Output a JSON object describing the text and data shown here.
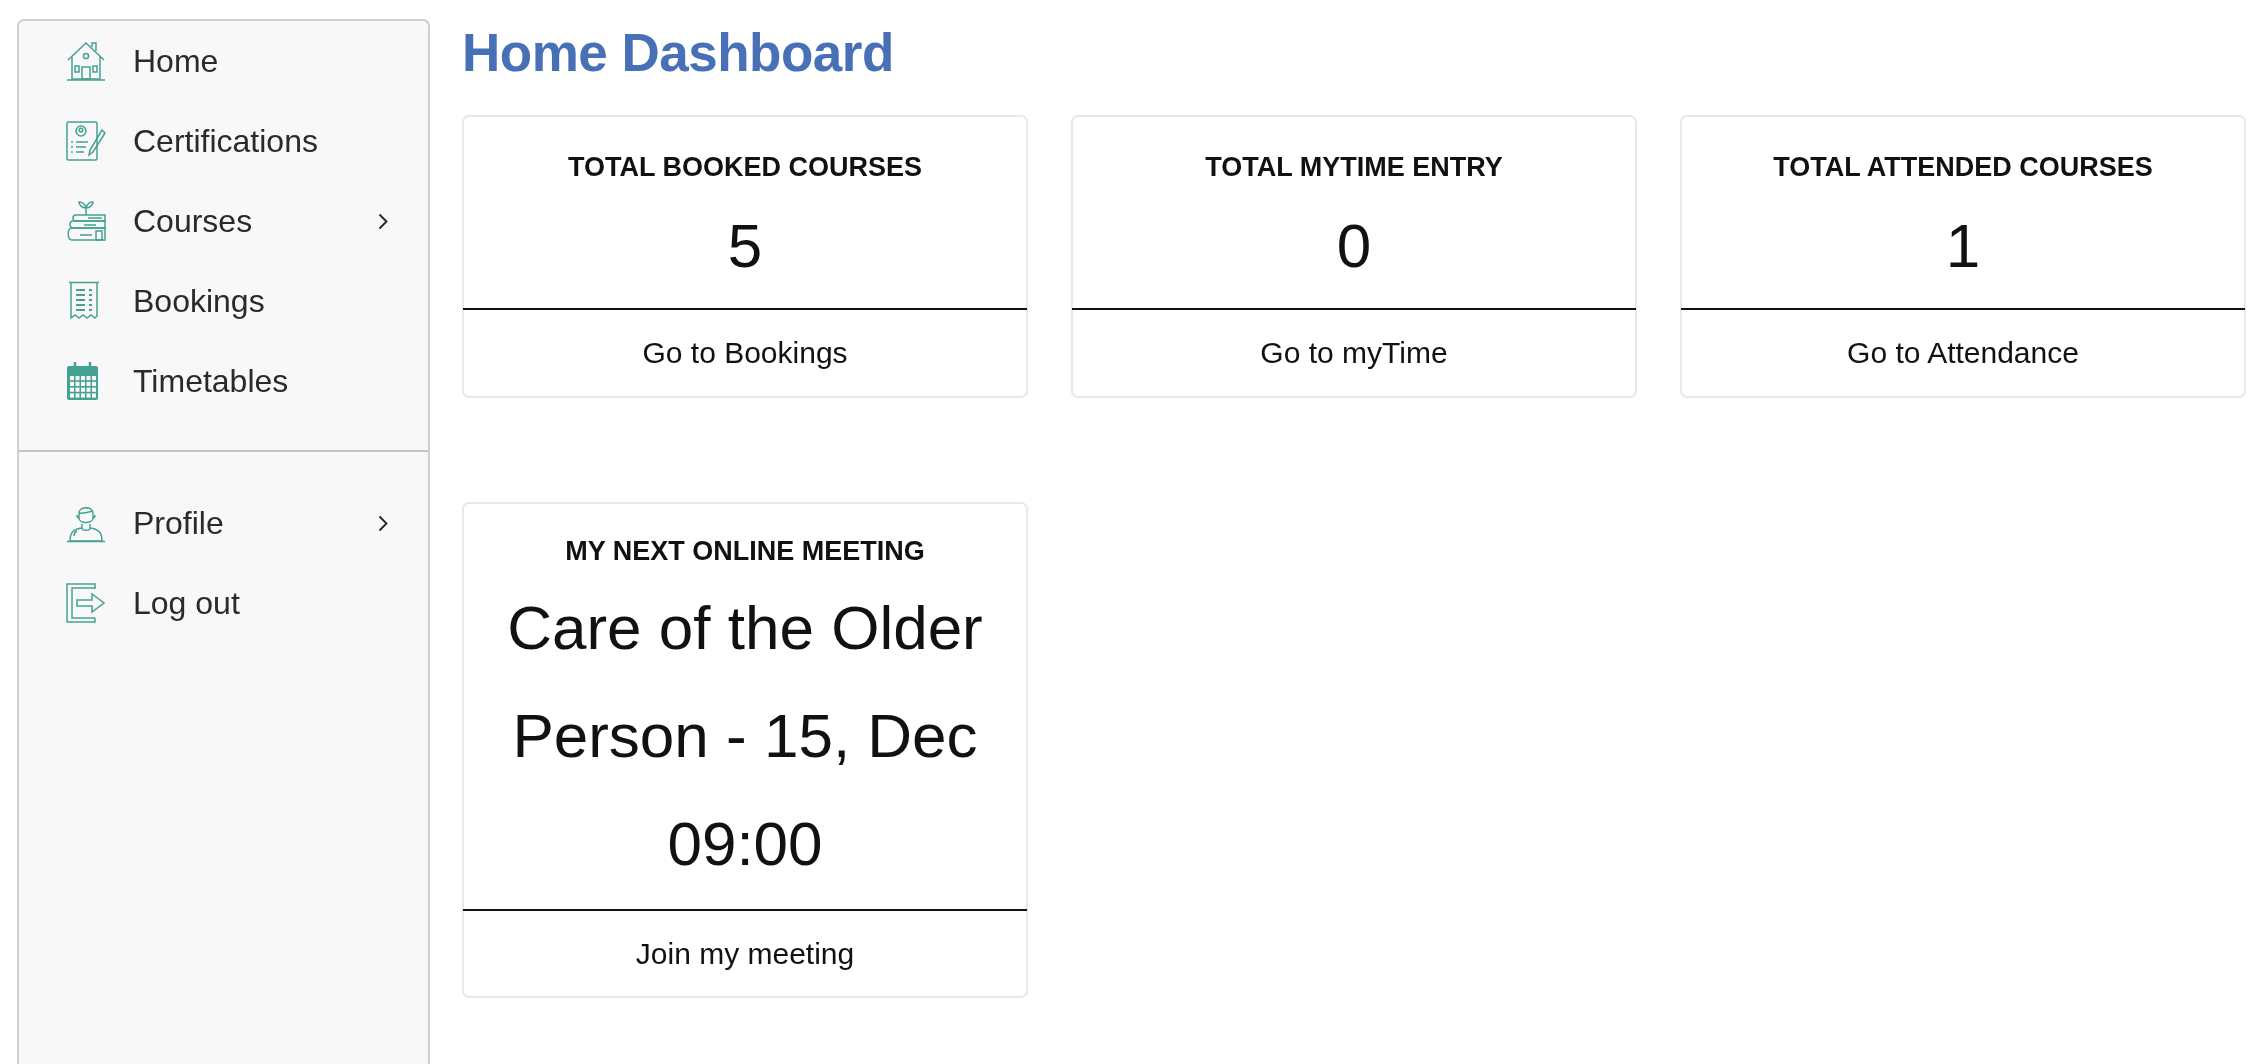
{
  "sidebar": {
    "sections": [
      {
        "items": [
          {
            "label": "Home",
            "has_submenu": false
          },
          {
            "label": "Certifications",
            "has_submenu": false
          },
          {
            "label": "Courses",
            "has_submenu": true
          },
          {
            "label": "Bookings",
            "has_submenu": false
          },
          {
            "label": "Timetables",
            "has_submenu": false
          }
        ]
      },
      {
        "items": [
          {
            "label": "Profile",
            "has_submenu": true
          },
          {
            "label": "Log out",
            "has_submenu": false
          }
        ]
      }
    ]
  },
  "page_title": "Home Dashboard",
  "stat_cards": [
    {
      "title": "TOTAL BOOKED COURSES",
      "value": "5",
      "link": "Go to Bookings"
    },
    {
      "title": "TOTAL MYTIME ENTRY",
      "value": "0",
      "link": "Go to myTime"
    },
    {
      "title": "TOTAL ATTENDED COURSES",
      "value": "1",
      "link": "Go to Attendance"
    }
  ],
  "meeting_card": {
    "title": "MY NEXT ONLINE MEETING",
    "text": "Care of the Older Person - 15, Dec 09:00",
    "link": "Join my meeting"
  }
}
